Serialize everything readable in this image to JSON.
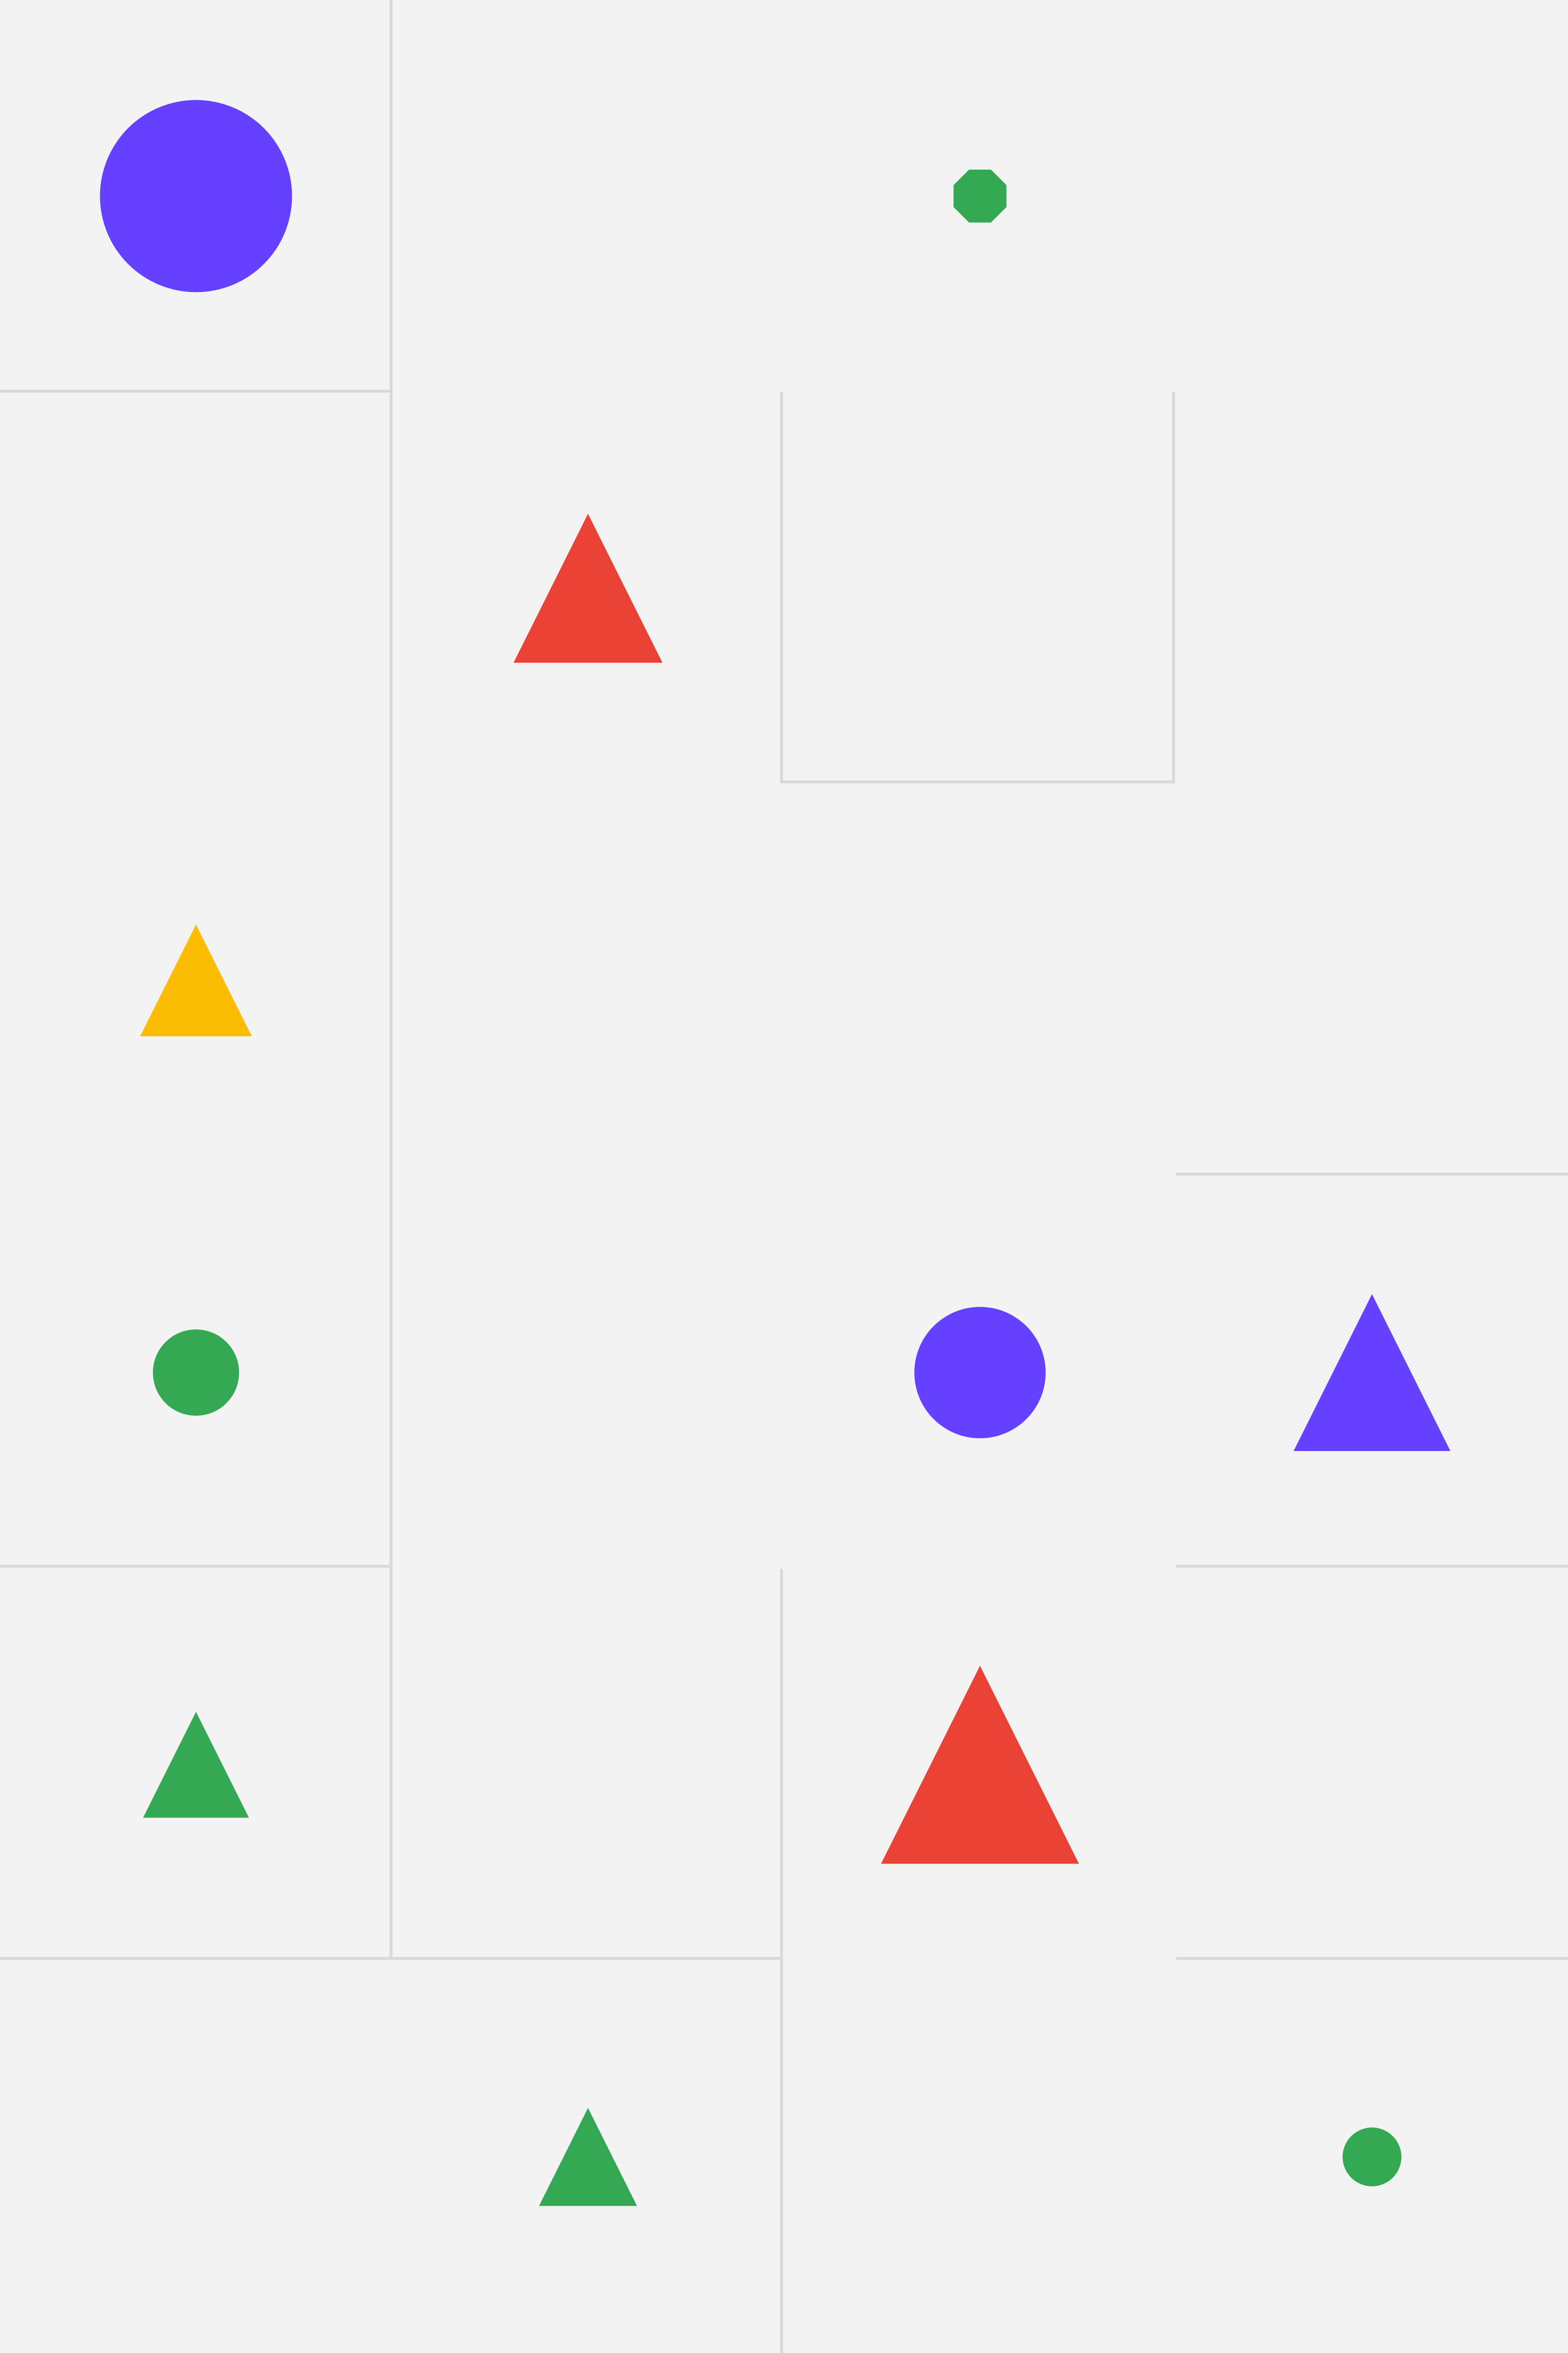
{
  "maze": {
    "columns": 4,
    "rows": 6,
    "colors": {
      "background": "#f3f3f3",
      "wall": "#d9d9d9"
    }
  },
  "palette": {
    "purple": "#6640ff",
    "green": "#34a853",
    "red": "#ea4335",
    "yellow": "#fbbc04"
  },
  "pieces": [
    {
      "id": "purple-circle-large",
      "shape": "circle",
      "color": "purple",
      "col": 0,
      "row": 0,
      "size": 0.98
    },
    {
      "id": "green-octagon-small",
      "shape": "octagon",
      "color": "green",
      "col": 2,
      "row": 0,
      "size": 0.27
    },
    {
      "id": "red-triangle",
      "shape": "triangle",
      "color": "red",
      "col": 1,
      "row": 1,
      "size": 0.76
    },
    {
      "id": "yellow-triangle",
      "shape": "triangle",
      "color": "yellow",
      "col": 0,
      "row": 2,
      "size": 0.57
    },
    {
      "id": "green-circle",
      "shape": "circle",
      "color": "green",
      "col": 0,
      "row": 3,
      "size": 0.44
    },
    {
      "id": "purple-circle",
      "shape": "circle",
      "color": "purple",
      "col": 2,
      "row": 3,
      "size": 0.67
    },
    {
      "id": "purple-triangle",
      "shape": "triangle",
      "color": "purple",
      "col": 3,
      "row": 3,
      "size": 0.8
    },
    {
      "id": "green-triangle",
      "shape": "triangle",
      "color": "green",
      "col": 0,
      "row": 4,
      "size": 0.54
    },
    {
      "id": "red-triangle-large",
      "shape": "triangle",
      "color": "red",
      "col": 2,
      "row": 4,
      "size": 1.01
    },
    {
      "id": "green-triangle-small",
      "shape": "triangle",
      "color": "green",
      "col": 1,
      "row": 5,
      "size": 0.5
    },
    {
      "id": "green-circle-small",
      "shape": "circle",
      "color": "green",
      "col": 3,
      "row": 5,
      "size": 0.3
    }
  ]
}
